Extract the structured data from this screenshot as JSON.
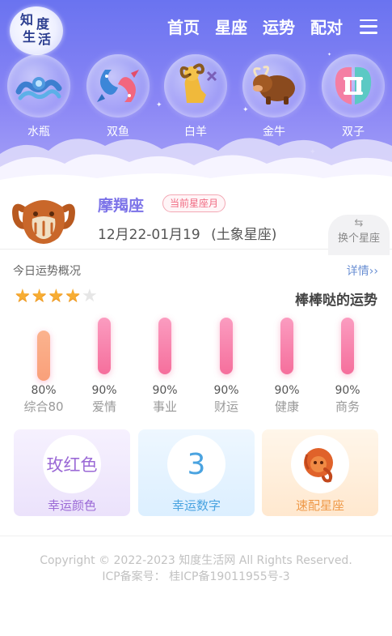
{
  "header": {
    "logo_chars": [
      "知",
      "度",
      "生",
      "活"
    ],
    "nav": [
      "首页",
      "星座",
      "运势",
      "配对"
    ]
  },
  "signs": [
    {
      "label": "水瓶",
      "icon": "aquarius-icon"
    },
    {
      "label": "双鱼",
      "icon": "pisces-icon"
    },
    {
      "label": "白羊",
      "icon": "aries-icon"
    },
    {
      "label": "金牛",
      "icon": "taurus-icon"
    },
    {
      "label": "双子",
      "icon": "gemini-icon"
    }
  ],
  "current": {
    "name": "摩羯座",
    "badge": "当前星座月",
    "date_range": "12月22-01月19",
    "element": "(土象星座)",
    "switch_label": "换个星座",
    "icon": "capricorn-icon"
  },
  "fortune": {
    "title": "今日运势概况",
    "detail_link": "详情››",
    "stars": 4,
    "stars_max": 5,
    "summary": "棒棒哒的运势",
    "items": [
      {
        "name": "综合80",
        "percent": "80%",
        "value": 80
      },
      {
        "name": "爱情",
        "percent": "90%",
        "value": 90
      },
      {
        "name": "事业",
        "percent": "90%",
        "value": 90
      },
      {
        "name": "财运",
        "percent": "90%",
        "value": 90
      },
      {
        "name": "健康",
        "percent": "90%",
        "value": 90
      },
      {
        "name": "商务",
        "percent": "90%",
        "value": 90
      }
    ]
  },
  "cards": {
    "lucky_color": {
      "value": "玫红色",
      "label": "幸运颜色"
    },
    "lucky_number": {
      "value": "3",
      "label": "幸运数字"
    },
    "best_match": {
      "icon": "leo-icon",
      "label": "速配星座"
    }
  },
  "footer": {
    "copyright": "Copyright © 2022-2023 知度生活网 All Rights Reserved.",
    "icp": "ICP备案号： 桂ICP备19011955号-3"
  },
  "colors": {
    "header_top": "#6a73f0",
    "accent_purple": "#7b72e8",
    "badge_pink": "#f06a82",
    "bar_orange": "#f9a07a",
    "bar_pink": "#f56f9c",
    "star": "#f7ad33",
    "lucky_color_text": "#9b6ad6",
    "lucky_number_text": "#4aa3e0",
    "match_text": "#ef9a4a"
  }
}
